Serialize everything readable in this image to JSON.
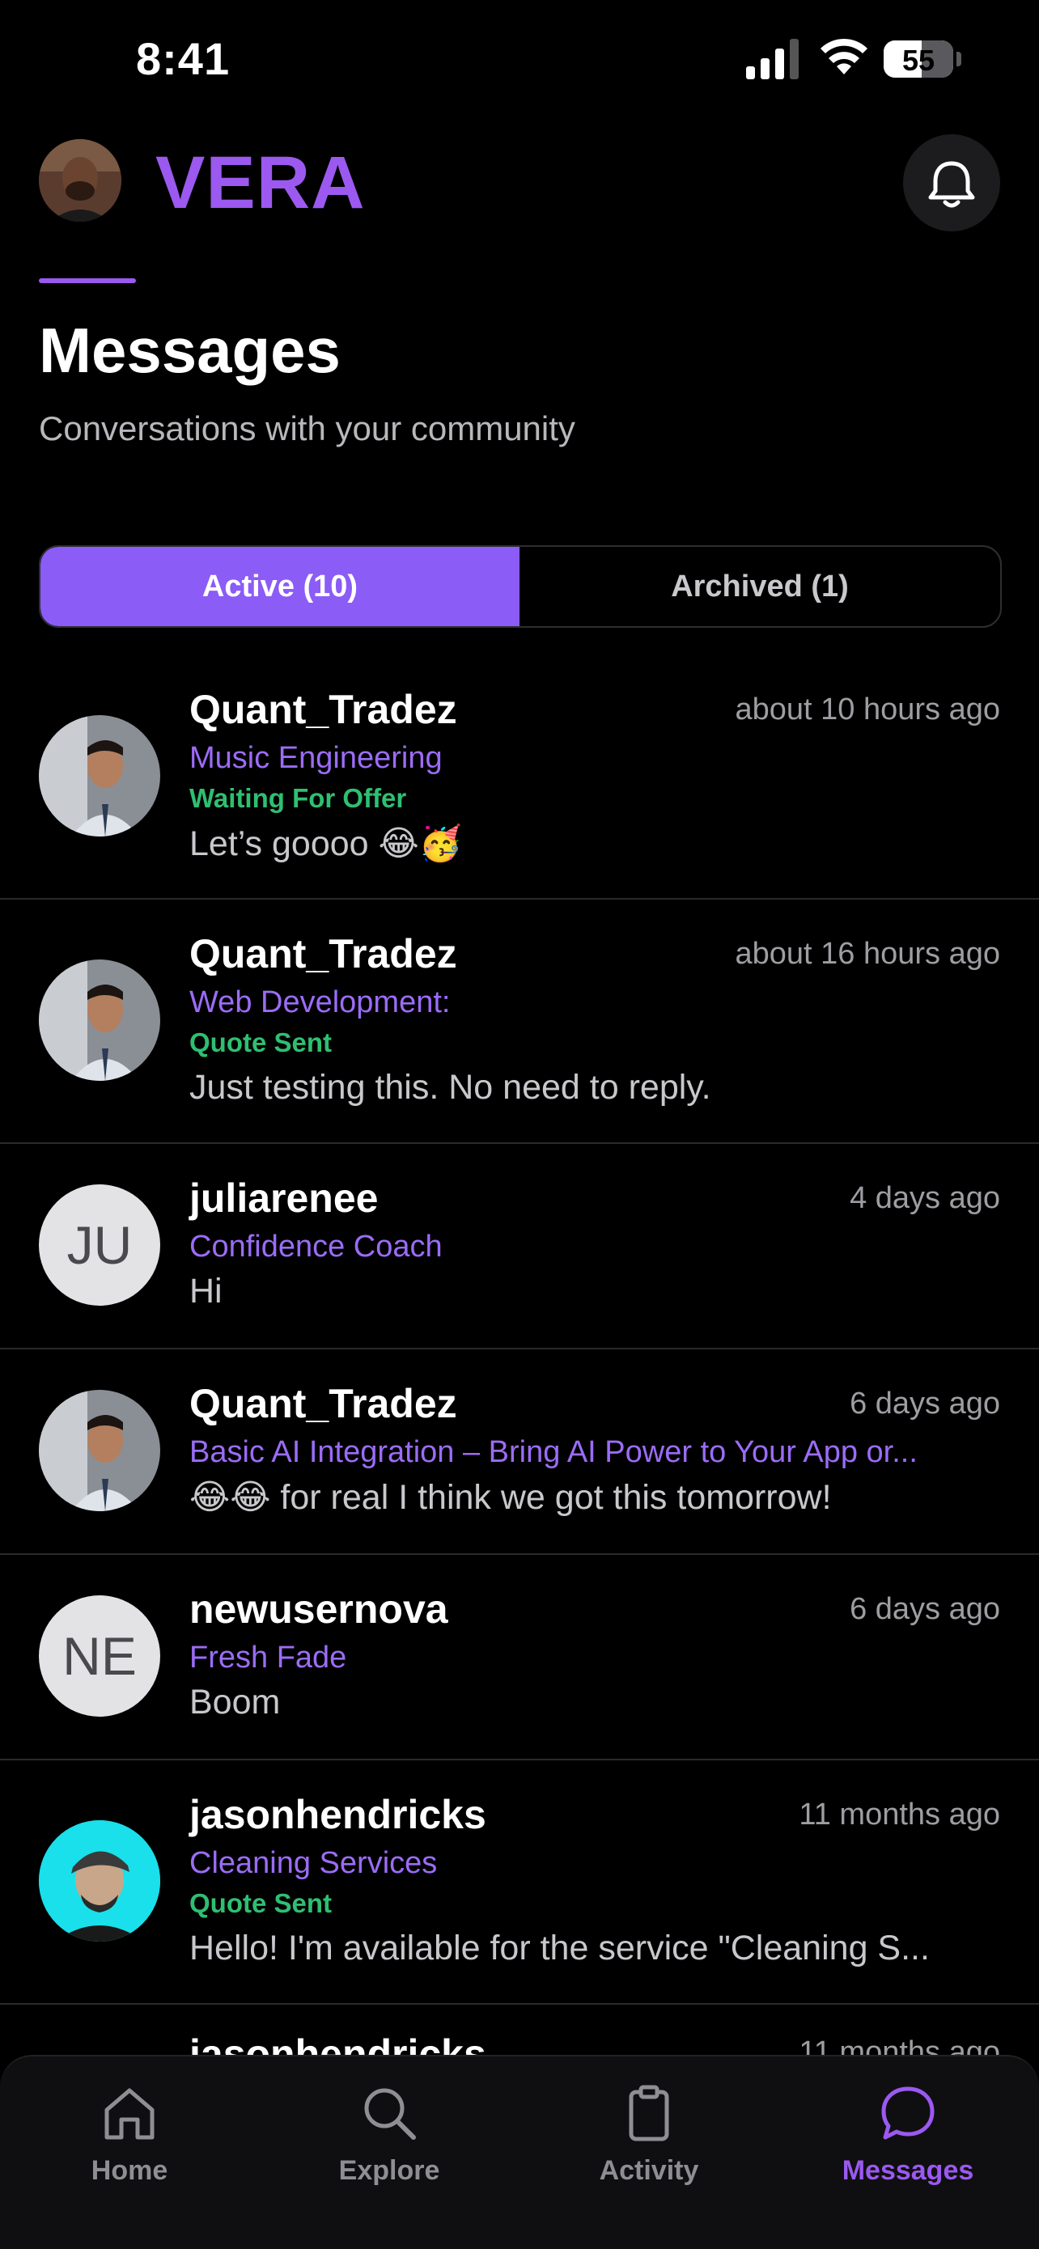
{
  "status_bar": {
    "time": "8:41",
    "battery": "55",
    "battery_level": 0.55
  },
  "header": {
    "brand": "VERA"
  },
  "page": {
    "title": "Messages",
    "subtitle": "Conversations with your community"
  },
  "tabs": {
    "active": "Active (10)",
    "archived": "Archived (1)"
  },
  "conversations": [
    {
      "name": "Quant_Tradez",
      "time": "about 10 hours ago",
      "service": "Music Engineering",
      "status": "Waiting For Offer",
      "message": "Let’s goooo 😂🥳",
      "avatar": "photo"
    },
    {
      "name": "Quant_Tradez",
      "time": "about 16 hours ago",
      "service": "Web Development:",
      "status": "Quote Sent",
      "message": "Just testing this. No need to reply.",
      "avatar": "photo"
    },
    {
      "name": "juliarenee",
      "time": "4 days ago",
      "service": "Confidence Coach",
      "status": "",
      "message": "Hi",
      "avatar": "JU"
    },
    {
      "name": "Quant_Tradez",
      "time": "6 days ago",
      "service": "Basic AI Integration – Bring AI Power to Your App or...",
      "status": "",
      "message": "😂😂 for real I think we got this tomorrow!",
      "avatar": "photo"
    },
    {
      "name": "newusernova",
      "time": "6 days ago",
      "service": "Fresh Fade",
      "status": "",
      "message": "Boom",
      "avatar": "NE"
    },
    {
      "name": "jasonhendricks",
      "time": "11 months ago",
      "service": "Cleaning Services",
      "status": "Quote Sent",
      "message": "Hello! I'm available for the service \"Cleaning S...",
      "avatar": "photo-cyan"
    },
    {
      "name": "jasonhendricks",
      "time": "11 months ago"
    }
  ],
  "tab_bar": {
    "home": "Home",
    "explore": "Explore",
    "activity": "Activity",
    "messages": "Messages"
  },
  "colors": {
    "accent": "#9b59f0",
    "status_green": "#2fbf71",
    "background": "#000000"
  },
  "icons": {
    "bell": "bell-icon",
    "home": "home-icon",
    "explore": "search-icon",
    "activity": "clipboard-icon",
    "messages": "chat-bubble-icon"
  }
}
